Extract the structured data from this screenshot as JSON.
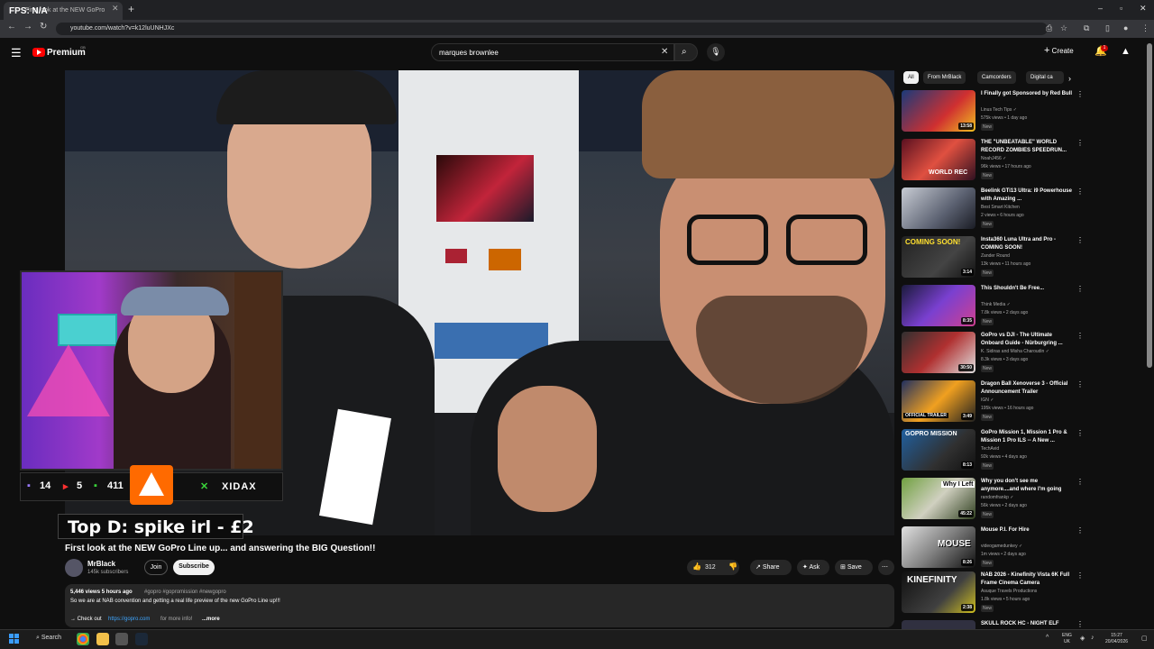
{
  "overlay": {
    "fps": "FPS: N/A"
  },
  "browser": {
    "tab_title": "First look at the NEW GoPro",
    "url": "youtube.com/watch?v=k12luUNHJXc"
  },
  "header": {
    "brand": "Premium",
    "region": "GB",
    "search_value": "marques brownlee",
    "create_label": "Create",
    "notif_count": "1"
  },
  "stream": {
    "stat_purple": "14",
    "stat_red": "5",
    "stat_green": "411",
    "sponsor": "XIDAX",
    "top_donor": "Top D: spike irl - £2"
  },
  "video": {
    "title": "First look at the NEW GoPro Line up... and answering the BIG Question!!",
    "channel": "MrBlack",
    "subs": "145k subscribers",
    "join": "Join",
    "subscribe": "Subscribe",
    "likes": "312",
    "share": "Share",
    "ask": "Ask",
    "save": "Save",
    "desc_stats": "5,446 views  5 hours ago",
    "desc_tags": "#gopro #gopromission #newgopro",
    "desc_line": "So we are at NAB convention and getting a real life preview of the new GoPro Line up!!!",
    "desc_check": "→ Check out",
    "desc_link": "https://gopro.com",
    "desc_more_info": "for more info!",
    "desc_more": "...more"
  },
  "chips": [
    "All",
    "From MrBlack",
    "Camcorders",
    "Digital ca"
  ],
  "recommendations": [
    {
      "title": "I Finally got Sponsored by Red Bull",
      "channel": "Linus Tech Tips ✓",
      "meta": "575k views • 1 day ago",
      "badge": "New",
      "duration": "13:58"
    },
    {
      "title": "THE \"UNBEATABLE\" WORLD RECORD ZOMBIES SPEEDRUN...",
      "channel": "NoahJ456 ✓",
      "meta": "96k views • 17 hours ago",
      "badge": "New",
      "duration": "",
      "thumb_text": "WORLD REC"
    },
    {
      "title": "Beelink GTi13 Ultra: i9 Powerhouse with Amazing ...",
      "channel": "Best Smart Kitchen",
      "meta": "2 views • 6 hours ago",
      "badge": "New",
      "duration": ""
    },
    {
      "title": "Insta360 Luna Ultra and Pro - COMING SOON!",
      "channel": "Zander Round",
      "meta": "13k views • 11 hours ago",
      "badge": "New",
      "duration": "3:14",
      "thumb_text": "COMING SOON!"
    },
    {
      "title": "This Shouldn't Be Free...",
      "channel": "Think Media ✓",
      "meta": "7.8k views • 2 days ago",
      "badge": "New",
      "duration": "8:35"
    },
    {
      "title": "GoPro vs DJI - The Ultimate Onboard Guide - Nürburgring ...",
      "channel": "K. Sidiras and Misha Charoudin ✓",
      "meta": "8.3k views • 3 days ago",
      "badge": "New",
      "duration": "30:50"
    },
    {
      "title": "Dragon Ball Xenoverse 3 - Official Announcement Trailer",
      "channel": "IGN ✓",
      "meta": "195k views • 16 hours ago",
      "badge": "New",
      "duration": "3:49",
      "thumb_text": "OFFICIAL TRAILER"
    },
    {
      "title": "GoPro Mission 1, Mission 1 Pro & Mission 1 Pro ILS -- A New ...",
      "channel": "TechAvid",
      "meta": "92k views • 4 days ago",
      "badge": "New",
      "duration": "8:13",
      "thumb_text": "GOPRO MISSION"
    },
    {
      "title": "Why you don't see me anymore....and where I'm going",
      "channel": "randomfrankp ✓",
      "meta": "56k views • 2 days ago",
      "badge": "New",
      "duration": "45:22",
      "thumb_text": "Why I Left"
    },
    {
      "title": "Mouse P.I. For Hire",
      "channel": "videogamedunkey ✓",
      "meta": "1m views • 2 days ago",
      "badge": "New",
      "duration": "8:26",
      "thumb_text": "MOUSE"
    },
    {
      "title": "NAB 2026 - Kinefinity Vista 6K Full Frame Cinema Camera",
      "channel": "Asuque Travels Productions",
      "meta": "1.8k views • 5 hours ago",
      "badge": "New",
      "duration": "2:38",
      "thumb_text": "KINEFINITY"
    },
    {
      "title": "SKULL ROCK HC - NIGHT ELF",
      "channel": "",
      "meta": "",
      "badge": "",
      "duration": ""
    }
  ],
  "taskbar": {
    "search": "Search",
    "lang": "ENG",
    "region": "UK",
    "time": "15:27",
    "date": "20/04/2026"
  },
  "colors": {
    "accent_red": "#ff0000",
    "link": "#3ea6ff",
    "bg": "#0f0f0f"
  }
}
